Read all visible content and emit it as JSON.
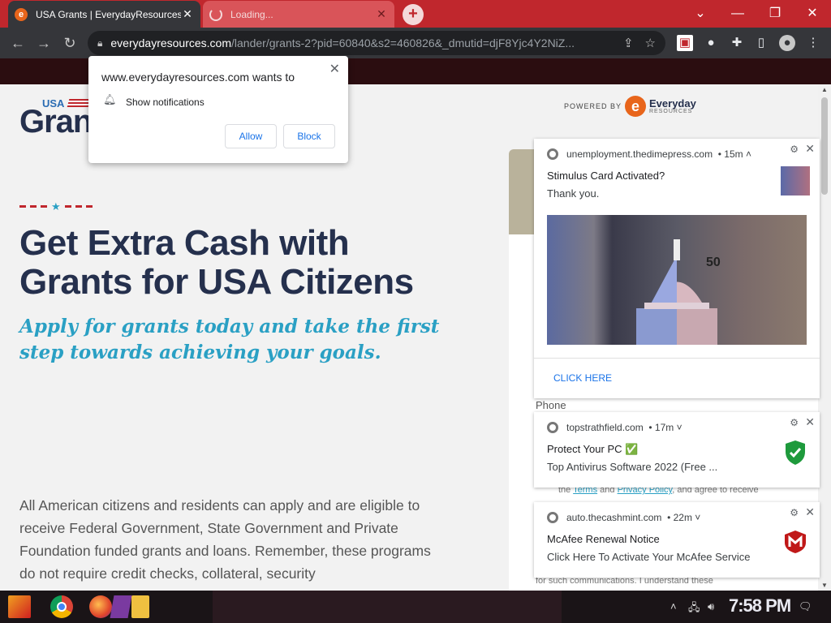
{
  "browser": {
    "tabs": [
      {
        "title": "USA Grants | EverydayResources",
        "favicon": "e",
        "active": true
      },
      {
        "title": "Loading...",
        "active": false
      }
    ],
    "new_tab": "+",
    "url_host": "everydayresources.com",
    "url_path": "/lander/grants-2?pid=60840&s2=460826&_dmutid=djF8Yjc4Y2NiZ...",
    "window_controls": [
      "chevron-down-icon",
      "minimize-icon",
      "restore-icon",
      "close-icon"
    ]
  },
  "permission_popup": {
    "title": "www.everydayresources.com wants to",
    "item": "Show notifications",
    "allow": "Allow",
    "block": "Block",
    "close": "✕"
  },
  "page": {
    "logo_small": "USA",
    "logo_big": "Gran",
    "powered_by": "POWERED BY",
    "brand_name": "Everyday",
    "brand_sub": "RESOURCES",
    "headline_1": "Get Extra Cash with",
    "headline_2": "Grants for USA Citizens",
    "subhead": "Apply for grants today and take the first step towards achieving your goals.",
    "body": "All American citizens and residents can apply and are eligible to receive Federal Government, State Government and Private Foundation funded grants and loans. Remember, these programs do not require credit checks, collateral, security",
    "phone_label": "Phone",
    "legal_pre": "the ",
    "legal_terms": "Terms",
    "legal_and": " and ",
    "legal_privacy": "Privacy Policy",
    "legal_post": ", and agree to receive",
    "legal_bottom": "for such communications. I understand these"
  },
  "notifications": [
    {
      "site": "unemployment.thedimepress.com",
      "age": "• 15m ˄",
      "title": "Stimulus Card Activated?",
      "body": "Thank you.",
      "image_text": "50",
      "cta": "CLICK HERE"
    },
    {
      "site": "topstrathfield.com",
      "age": "• 17m ˅",
      "title": "Protect Your PC ✅",
      "body": "Top Antivirus Software 2022 (Free ..."
    },
    {
      "site": "auto.thecashmint.com",
      "age": "• 22m ˅",
      "title": "McAfee Renewal Notice",
      "body": "Click Here To Activate Your McAfee Service"
    }
  ],
  "taskbar": {
    "clock": "7:58 PM",
    "apps": [
      "start-icon",
      "chrome-icon",
      "firefox-icon",
      "media-icon",
      "folder-icon"
    ]
  },
  "colors": {
    "tab_bar": "#c0272d",
    "headline": "#25304d",
    "accent_blue": "#2aa0c4",
    "link_blue": "#1a73e8"
  }
}
